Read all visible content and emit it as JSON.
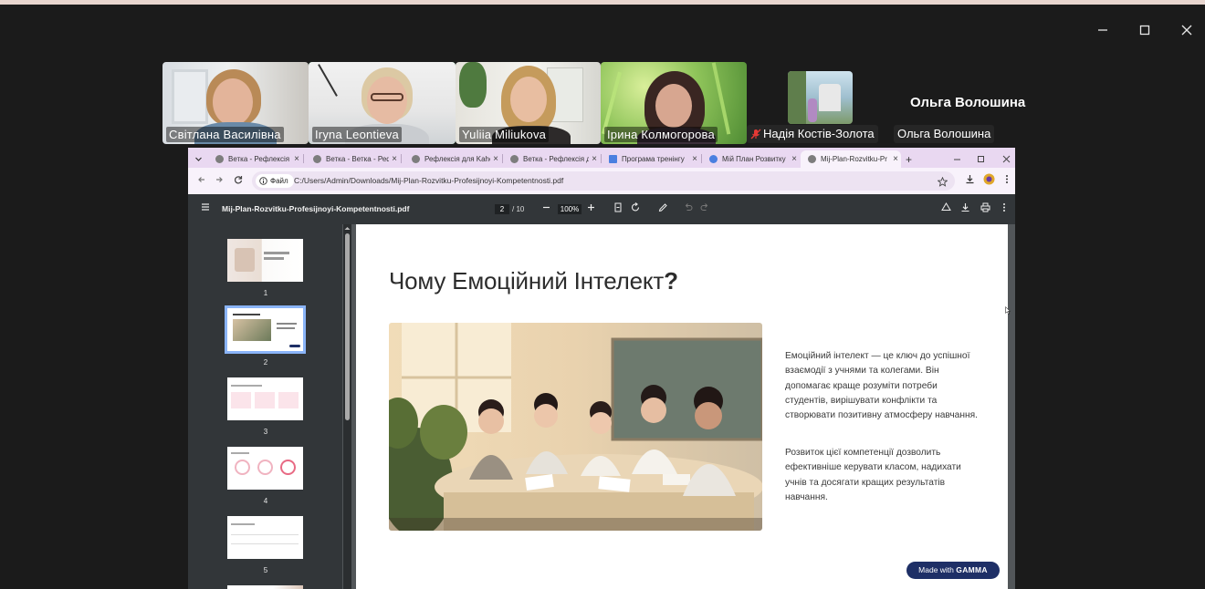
{
  "participants": [
    {
      "name": "Світлана Василівна"
    },
    {
      "name": "Iryna Leontieva"
    },
    {
      "name": "Yuliia Miliukova"
    },
    {
      "name": "Ірина Колмогорова"
    },
    {
      "name": "Надія Костів-Золота"
    },
    {
      "name": "Ольга Волошина"
    }
  ],
  "featured_name": "Ольга Волошина",
  "browser": {
    "tabs": [
      {
        "title": "Ветка - Рефлексія для",
        "close": "×"
      },
      {
        "title": "Ветка - Ветка - Рефл",
        "close": "×"
      },
      {
        "title": "Рефлексія для Kahoo",
        "close": "×"
      },
      {
        "title": "Ветка - Рефлексія для",
        "close": "×"
      },
      {
        "title": "Програма тренінгу",
        "close": "×"
      },
      {
        "title": "Мій План Розвитку",
        "close": "×"
      },
      {
        "title": "Mij-Plan-Rozvitku-Pr",
        "close": "×"
      }
    ],
    "new_tab": "+",
    "file_chip": "Файл",
    "url": "C:/Users/Admin/Downloads/Mij-Plan-Rozvitku-Profesijnoyi-Kompetentnosti.pdf"
  },
  "pdf": {
    "file_name": "Mij-Plan-Rozvitku-Profesijnoyi-Kompetentnosti.pdf",
    "current_page": "2",
    "page_total": "/ 10",
    "zoom": "100%",
    "thumbnails": [
      "1",
      "2",
      "3",
      "4",
      "5"
    ],
    "selected_page": "2"
  },
  "slide": {
    "title": "Чому Емоційний Інтелект",
    "title_mark": "?",
    "paragraph1": "Емоційний інтелект — це ключ до успішної взаємодії з учнями та колегами. Він допомагає краще розуміти потреби студентів, вирішувати конфлікти та створювати позитивну атмосферу навчання.",
    "paragraph2": "Розвиток цієї компетенції дозволить ефективніше керувати класом, надихати учнів та досягати кращих результатів навчання.",
    "badge_prefix": "Made with",
    "badge_brand": "GAMMA"
  },
  "colors": {
    "background": "#1b1b1b",
    "active_speaker": "#3ecf74",
    "tab_strip": "#e9d8f1",
    "pdf_toolbar": "#323639",
    "gamma_badge": "#1e2f66",
    "muted_mic": "#e53935"
  }
}
